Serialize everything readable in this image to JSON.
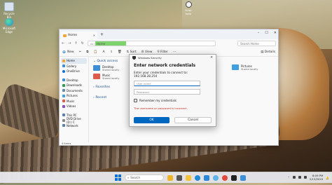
{
  "desktop": {
    "icons": [
      {
        "label": "Recycle Bin",
        "color": "#d9e3ef"
      },
      {
        "label": "Microsoft Edge",
        "color": "#1f8bd8"
      }
    ],
    "top_icon": {
      "label": "Drop here"
    }
  },
  "explorer": {
    "tab_label": "Home",
    "address_segment": "Home",
    "search_placeholder": "Search Home",
    "toolbar": {
      "new_label": "New",
      "sort_label": "Sort",
      "view_label": "View",
      "filter_label": "Filter",
      "details_label": "Details"
    },
    "sidebar": {
      "items": [
        {
          "label": "Home",
          "active": true,
          "color": "#f3a53a"
        },
        {
          "label": "Gallery",
          "color": "#3a8fd8"
        },
        {
          "label": "OneDrive",
          "color": "#0a70d6"
        },
        {
          "label": "Desktop",
          "color": "#3a8fd8"
        },
        {
          "label": "Downloads",
          "color": "#2e9b55"
        },
        {
          "label": "Documents",
          "color": "#6c8aa8"
        },
        {
          "label": "Pictures",
          "color": "#3ea0e0"
        },
        {
          "label": "Music",
          "color": "#e05a4a"
        },
        {
          "label": "Videos",
          "color": "#8a4fc0"
        },
        {
          "label": "This PC",
          "color": "#5a7fa8"
        },
        {
          "label": "DVD Drive (D:) C",
          "color": "#888888"
        },
        {
          "label": "Network",
          "color": "#5a7fa8"
        }
      ]
    },
    "quick_access": {
      "title": "Quick access",
      "items": [
        {
          "name": "Desktop",
          "sub": "Stored locally",
          "color": "#3a8fd8"
        },
        {
          "name": "Music",
          "sub": "Stored locally",
          "color": "#e05a4a"
        }
      ],
      "right_item": {
        "name": "Pictures",
        "sub": "Stored locally",
        "color": "#3ea0e0"
      }
    },
    "favorites_title": "Favorites",
    "recent_title": "Recent",
    "status": "4 items"
  },
  "dialog": {
    "title": "Windows Security",
    "heading": "Enter network credentials",
    "prompt": "Enter your credentials to connect to: 192.168.28.254",
    "user_placeholder": "User name",
    "password_placeholder": "Password",
    "remember_label": "Remember my credentials",
    "error": "The username or password is incorrect.",
    "ok_label": "OK",
    "cancel_label": "Cancel"
  },
  "taskbar": {
    "search_label": "Search",
    "apps": [
      {
        "name": "widgets",
        "color": "#f0b429"
      },
      {
        "name": "task-view",
        "color": "#555555"
      },
      {
        "name": "explorer",
        "color": "#f3c13a"
      },
      {
        "name": "edge",
        "color": "#1f8bd8"
      },
      {
        "name": "store",
        "color": "#2b88d8"
      },
      {
        "name": "copilot",
        "color": "#5fb3e8"
      },
      {
        "name": "chrome",
        "color": "#e2483d"
      },
      {
        "name": "terminal",
        "color": "#222222"
      },
      {
        "name": "settings",
        "color": "#3a8fd8"
      }
    ],
    "time": "8:09 PM",
    "date": "2/13/2025"
  }
}
